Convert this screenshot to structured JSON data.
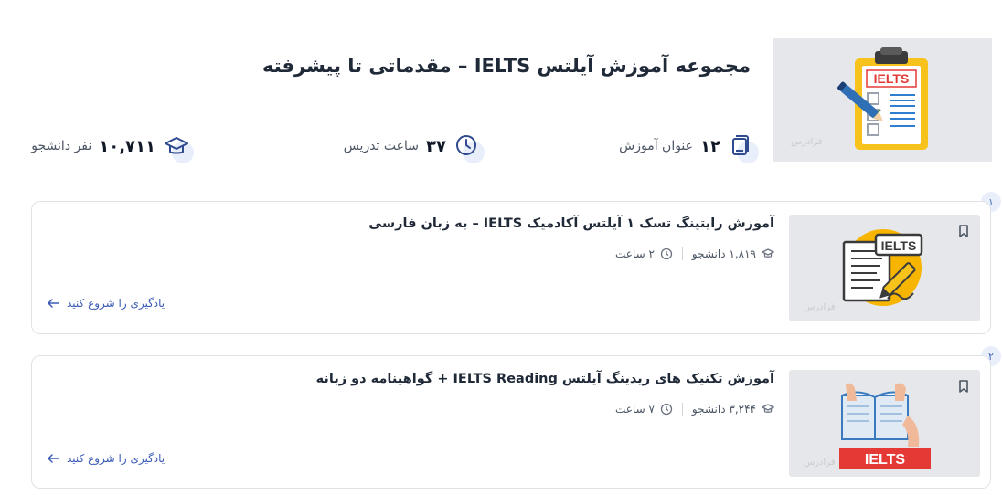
{
  "header": {
    "title": "مجموعه آموزش آیلتس IELTS – مقدماتی تا پیشرفته",
    "thumbnail_text": "IELTS",
    "watermark": "فرادرس",
    "stats": [
      {
        "icon": "book-stack-icon",
        "value": "۱۲",
        "label": "عنوان آموزش"
      },
      {
        "icon": "clock-icon",
        "value": "۳۷",
        "label": "ساعت تدریس"
      },
      {
        "icon": "graduation-cap-icon",
        "value": "۱۰,۷۱۱",
        "label": "نفر دانشجو"
      }
    ]
  },
  "courses": [
    {
      "index": "۱",
      "title": "آموزش رایتینگ تسک ۱ آیلتس آکادمیک IELTS – به زبان فارسی",
      "students": "۱,۸۱۹ دانشجو",
      "duration": "۲ ساعت",
      "cta": "یادگیری را شروع کنید",
      "thumbnail_text": "IELTS",
      "watermark": "فرادرس"
    },
    {
      "index": "۲",
      "title": "آموزش تکنیک های ریدینگ آیلتس IELTS Reading + گواهینامه دو زبانه",
      "students": "۳,۲۴۴ دانشجو",
      "duration": "۷ ساعت",
      "cta": "یادگیری را شروع کنید",
      "thumbnail_text": "IELTS",
      "watermark": "فرادرس"
    }
  ],
  "colors": {
    "accent": "#3b5bb5",
    "icon": "#2f4a8f",
    "thumb_bg": "#e6e7ea",
    "ielts_red": "#e53935",
    "clipboard_yellow": "#f7c21b"
  }
}
